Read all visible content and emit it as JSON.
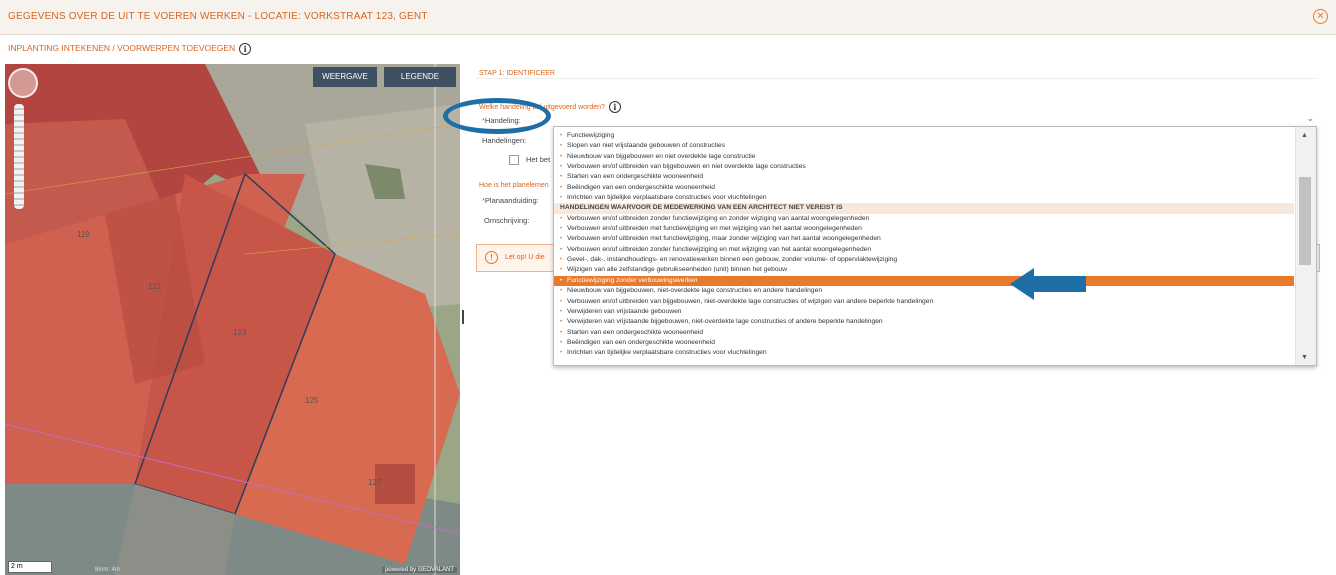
{
  "header": {
    "title": "GEGEVENS OVER DE UIT TE VOEREN WERKEN - LOCATIE: VORKSTRAAT 123, GENT",
    "close_icon": "close-circle-icon"
  },
  "subheader": {
    "label": "INPLANTING INTEKENEN / VOORWERPEN TOEVOEGEN",
    "info": "i"
  },
  "map": {
    "weergave_button": "WEERGAVE",
    "legende_button": "LEGENDE",
    "plot_numbers": [
      "119",
      "121",
      "123",
      "125",
      "127"
    ],
    "scale": "2 m",
    "scale_secondary": "8mm: 4m",
    "credit": "powered by GEOVALANT"
  },
  "form": {
    "step_title": "STAP 1: IDENTIFICEER",
    "question_action": "Welke handeling zal uitgevoerd worden?",
    "handeling_label": "Handeling:",
    "handelingen_label": "Handelingen:",
    "checkbox_label": "Het bet",
    "question_plan": "Hoe is het planelemen",
    "planaanduiding_label": "Planaanduiding:",
    "omschrijving_label": "Omschrijving:",
    "warning_text": "Let op! U die",
    "required_mark": "*"
  },
  "dropdown": {
    "items": [
      {
        "type": "option",
        "label": "Functiewijziging"
      },
      {
        "type": "option",
        "label": "Slopen van niet vrijstaande gebouwen of constructies"
      },
      {
        "type": "option",
        "label": "Nieuwbouw van bijgebouwen en niet overdekte lage constructie"
      },
      {
        "type": "option",
        "label": "Verbouwen en/of uitbreiden van bijgebouwen en niet overdekte lage constructies"
      },
      {
        "type": "option",
        "label": "Starten van een ondergeschikte wooneenheid"
      },
      {
        "type": "option",
        "label": "Beëindigen van een ondergeschikte wooneenheid"
      },
      {
        "type": "option",
        "label": "Inrichten van tijdelijke verplaatsbare constructies voor vluchtelingen"
      },
      {
        "type": "group",
        "label": "HANDELINGEN WAARVOOR DE MEDEWERKING VAN EEN ARCHITECT NIET VEREIST IS"
      },
      {
        "type": "option",
        "label": "Verbouwen en/of uitbreiden zonder functiewijziging en zonder wijziging van aantal woongelegenheden"
      },
      {
        "type": "option",
        "label": "Verbouwen en/of uitbreiden met functiewijziging en met wijziging van het aantal woongelegenheden"
      },
      {
        "type": "option",
        "label": "Verbouwen en/of uitbreiden met functiewijziging, maar zonder wijziging van het aantal woongelegenheden"
      },
      {
        "type": "option",
        "label": "Verbouwen en/of uitbreiden zonder functiewijziging en met wijziging van het aantal woongelegenheden"
      },
      {
        "type": "option",
        "label": "Gevel-, dak-, instandhoudings- en renovatiewerken binnen een gebouw, zonder volume- of oppervlaktewijziging"
      },
      {
        "type": "option",
        "label": "Wijzigen van alle zelfstandige gebruikseenheden (unit) binnen het gebouw"
      },
      {
        "type": "selected",
        "label": "Functiewijziging zonder verbouwingswerken"
      },
      {
        "type": "option",
        "label": "Nieuwbouw van bijgebouwen, niet-overdekte lage constructies en andere handelingen"
      },
      {
        "type": "option",
        "label": "Verbouwen en/of uitbreiden van bijgebouwen, niet-overdekte lage constructies of wijzigen van andere beperkte handelingen"
      },
      {
        "type": "option",
        "label": "Verwijderen van vrijstaande gebouwen"
      },
      {
        "type": "option",
        "label": "Verwijderen van vrijstaande bijgebouwen, niet-overdekte lage constructies of andere beperkte handelingen"
      },
      {
        "type": "option",
        "label": "Starten van een ondergeschikte wooneenheid"
      },
      {
        "type": "option",
        "label": "Beëindigen van een ondergeschikte wooneenheid"
      },
      {
        "type": "option",
        "label": "Inrichten van tijdelijke verplaatsbare constructies voor vluchtelingen"
      }
    ],
    "bullet": "•",
    "scroll_up": "▲",
    "scroll_down": "▼"
  },
  "colors": {
    "accent": "#e8792d",
    "annotation": "#1e6fa6",
    "map_button": "#3f5063"
  }
}
